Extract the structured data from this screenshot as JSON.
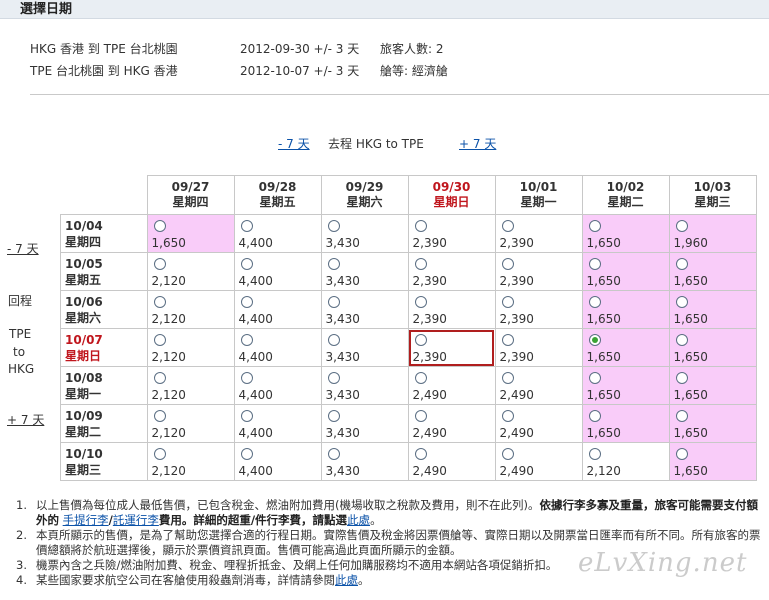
{
  "header": {
    "title": "選擇日期"
  },
  "summary": {
    "outbound": {
      "route": "HKG 香港 到 TPE 台北桃園",
      "date": "2012-09-30  +/- 3 天",
      "info": "旅客人數: 2"
    },
    "return": {
      "route": "TPE 台北桃園 到 HKG 香港",
      "date": "2012-10-07  +/- 3 天",
      "info": "艙等: 經濟艙"
    }
  },
  "nav": {
    "prev": "- 7 天",
    "label": "去程   HKG  to  TPE",
    "next": "+ 7 天"
  },
  "side": {
    "prev": "- 7 天",
    "return_label": "回程",
    "from": "TPE",
    "to": "to",
    "dest": "HKG",
    "next": "+ 7 天"
  },
  "columns": [
    {
      "date": "09/27",
      "day": "星期四"
    },
    {
      "date": "09/28",
      "day": "星期五"
    },
    {
      "date": "09/29",
      "day": "星期六"
    },
    {
      "date": "09/30",
      "day": "星期日"
    },
    {
      "date": "10/01",
      "day": "星期一"
    },
    {
      "date": "10/02",
      "day": "星期二"
    },
    {
      "date": "10/03",
      "day": "星期三"
    }
  ],
  "rows": [
    {
      "date": "10/04",
      "day": "星期四",
      "prices": [
        "1,650",
        "4,400",
        "3,430",
        "2,390",
        "2,390",
        "1,650",
        "1,960"
      ]
    },
    {
      "date": "10/05",
      "day": "星期五",
      "prices": [
        "2,120",
        "4,400",
        "3,430",
        "2,390",
        "2,390",
        "1,650",
        "1,650"
      ]
    },
    {
      "date": "10/06",
      "day": "星期六",
      "prices": [
        "2,120",
        "4,400",
        "3,430",
        "2,390",
        "2,390",
        "1,650",
        "1,650"
      ]
    },
    {
      "date": "10/07",
      "day": "星期日",
      "prices": [
        "2,120",
        "4,400",
        "3,430",
        "2,390",
        "2,390",
        "1,650",
        "1,650"
      ]
    },
    {
      "date": "10/08",
      "day": "星期一",
      "prices": [
        "2,120",
        "4,400",
        "3,430",
        "2,490",
        "2,490",
        "1,650",
        "1,650"
      ]
    },
    {
      "date": "10/09",
      "day": "星期二",
      "prices": [
        "2,120",
        "4,400",
        "3,430",
        "2,490",
        "2,490",
        "1,650",
        "1,650"
      ]
    },
    {
      "date": "10/10",
      "day": "星期三",
      "prices": [
        "2,120",
        "4,400",
        "3,430",
        "2,490",
        "2,490",
        "2,120",
        "1,650"
      ]
    }
  ],
  "notes": [
    {
      "n": "1.",
      "pre": "以上售價為每位成人最低售價，已包含稅金、燃油附加費用(機場收取之稅款及費用，則不在此列)。",
      "bold": "依據行李多寡及重量，旅客可能需要支付額外的",
      "link1": "手提行李",
      "sep": "/",
      "link2": "託運行李",
      "post": "費用。詳細的超重/件行李費，請點選",
      "link3": "此處",
      "end": "。"
    },
    {
      "n": "2.",
      "text": "本頁所顯示的售價，是為了幫助您選擇合適的行程日期。實際售價及稅金將因票價艙等、實際日期以及開票當日匯率而有所不同。所有旅客的票價總額將於航班選擇後，顯示於票價資訊頁面。售價可能高過此頁面所顯示的金額。"
    },
    {
      "n": "3.",
      "text": "機票內含之兵險/燃油附加費、稅金、哩程折抵金、及網上任何加購服務均不適用本網站各項促銷折扣。"
    },
    {
      "n": "4.",
      "pre": "某些國家要求航空公司在客艙使用殺蟲劑消毒，詳情請參閱",
      "link": "此處",
      "end": "。"
    }
  ],
  "watermark": "eLvXing.net",
  "colors": {
    "highlight": "#f9ccf9",
    "selected_text": "#c0161d",
    "selected_border": "#b01e1e",
    "link": "#0b52a8",
    "radio_on": "#3aa335"
  }
}
